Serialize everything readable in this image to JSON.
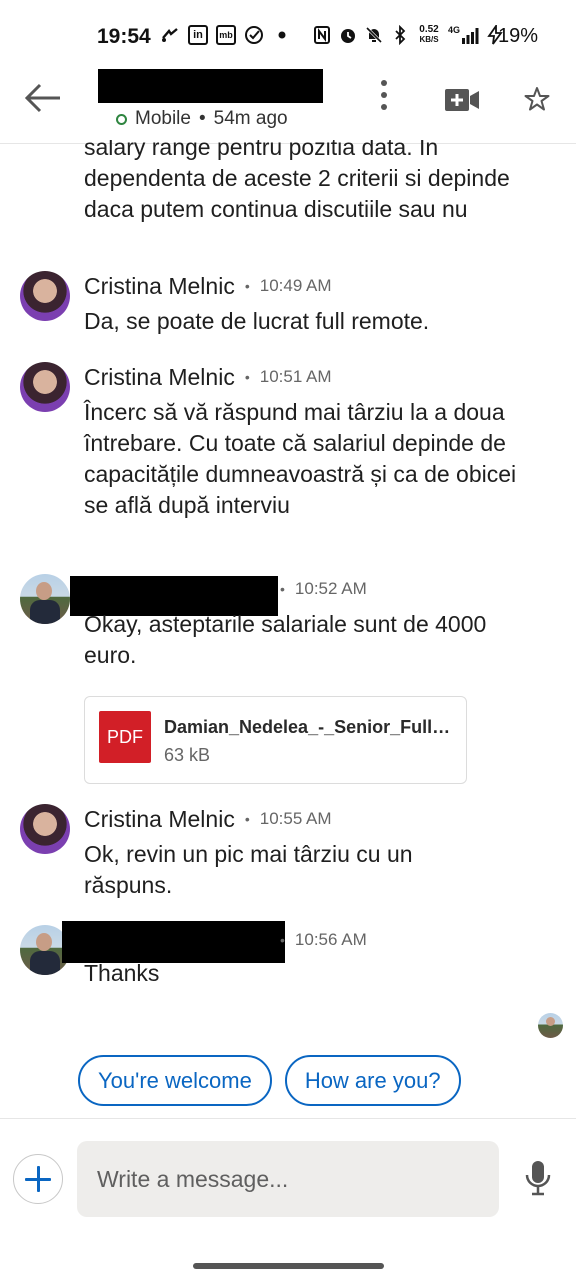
{
  "status_bar": {
    "time": "19:54",
    "net_speed_top": "0.52",
    "net_speed_bottom": "KB/S",
    "network": "4G",
    "battery": "19%",
    "left_icons": [
      "wifi-calling-icon",
      "linkedin-icon",
      "mb-icon",
      "check-circle-icon",
      "dot-icon"
    ],
    "right_icons": [
      "nfc-icon",
      "alarm-icon",
      "bell-off-icon",
      "bluetooth-icon",
      "signal-icon",
      "battery-charging-icon"
    ]
  },
  "header": {
    "presence": "Mobile",
    "separator": "•",
    "last_seen": "54m ago"
  },
  "conversation": {
    "continued_text": "salary range pentru pozitia data. In dependenta de aceste 2 criterii si depinde daca putem continua discutiile sau nu",
    "messages": [
      {
        "sender": "Cristina Melnic",
        "time": "10:49 AM",
        "text": "Da, se poate de lucrat full remote."
      },
      {
        "sender": "Cristina Melnic",
        "time": "10:51 AM",
        "text": "Încerc să vă răspund mai târziu la a doua întrebare. Cu toate că salariul depinde de capacitățile dumneavoastră și ca de obicei se află după interviu"
      },
      {
        "sender": "",
        "time": "10:52 AM",
        "text": "Okay, asteptarile salariale sunt de 4000 euro.",
        "attachment": {
          "type_label": "PDF",
          "name": "Damian_Nedelea_-_Senior_Full_...",
          "size": "63 kB"
        }
      },
      {
        "sender": "Cristina Melnic",
        "time": "10:55 AM",
        "text": "Ok, revin un pic mai târziu cu un răspuns."
      },
      {
        "sender": "",
        "time": "10:56 AM",
        "text": "Thanks"
      }
    ],
    "bullet": "•"
  },
  "smart_replies": [
    "You're welcome",
    "How are you?"
  ],
  "composer": {
    "placeholder": "Write a message..."
  },
  "colors": {
    "accent": "#0a66c2",
    "pdf_red": "#d21f27",
    "presence_green": "#2e8540"
  }
}
